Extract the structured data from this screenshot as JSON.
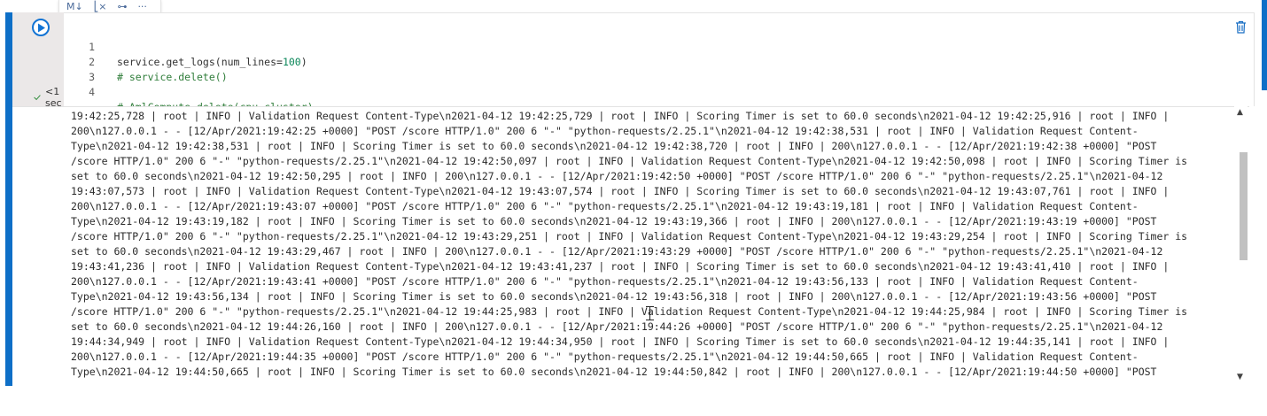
{
  "cell_toolbar": {
    "markdown_label": "M↓",
    "clear_label": "⎣×",
    "split_label": "⊶",
    "more_label": "···"
  },
  "code": {
    "lines": [
      {
        "no": "1",
        "text": "service.get_logs(num_lines=100)"
      },
      {
        "no": "2",
        "text": "# service.delete()"
      },
      {
        "no": "3",
        "text": ""
      },
      {
        "no": "4",
        "text": "# AmlCompute.delete(cpu_cluster)"
      }
    ]
  },
  "execution": {
    "status_icon": "checkmark-icon",
    "duration": "<1 sec"
  },
  "output": {
    "lines": [
      "19:42:25,728 | root | INFO | Validation Request Content-Type\\n2021-04-12 19:42:25,729 | root | INFO | Scoring Timer is set to 60.0 seconds\\n2021-04-12 19:42:25,916 | root | INFO |",
      "200\\n127.0.0.1 - - [12/Apr/2021:19:42:25 +0000] \"POST /score HTTP/1.0\" 200 6 \"-\" \"python-requests/2.25.1\"\\n2021-04-12 19:42:38,531 | root | INFO | Validation Request Content-",
      "Type\\n2021-04-12 19:42:38,531 | root | INFO | Scoring Timer is set to 60.0 seconds\\n2021-04-12 19:42:38,720 | root | INFO | 200\\n127.0.0.1 - - [12/Apr/2021:19:42:38 +0000] \"POST",
      "/score HTTP/1.0\" 200 6 \"-\" \"python-requests/2.25.1\"\\n2021-04-12 19:42:50,097 | root | INFO | Validation Request Content-Type\\n2021-04-12 19:42:50,098 | root | INFO | Scoring Timer is",
      "set to 60.0 seconds\\n2021-04-12 19:42:50,295 | root | INFO | 200\\n127.0.0.1 - - [12/Apr/2021:19:42:50 +0000] \"POST /score HTTP/1.0\" 200 6 \"-\" \"python-requests/2.25.1\"\\n2021-04-12",
      "19:43:07,573 | root | INFO | Validation Request Content-Type\\n2021-04-12 19:43:07,574 | root | INFO | Scoring Timer is set to 60.0 seconds\\n2021-04-12 19:43:07,761 | root | INFO |",
      "200\\n127.0.0.1 - - [12/Apr/2021:19:43:07 +0000] \"POST /score HTTP/1.0\" 200 6 \"-\" \"python-requests/2.25.1\"\\n2021-04-12 19:43:19,181 | root | INFO | Validation Request Content-",
      "Type\\n2021-04-12 19:43:19,182 | root | INFO | Scoring Timer is set to 60.0 seconds\\n2021-04-12 19:43:19,366 | root | INFO | 200\\n127.0.0.1 - - [12/Apr/2021:19:43:19 +0000] \"POST",
      "/score HTTP/1.0\" 200 6 \"-\" \"python-requests/2.25.1\"\\n2021-04-12 19:43:29,251 | root | INFO | Validation Request Content-Type\\n2021-04-12 19:43:29,254 | root | INFO | Scoring Timer is",
      "set to 60.0 seconds\\n2021-04-12 19:43:29,467 | root | INFO | 200\\n127.0.0.1 - - [12/Apr/2021:19:43:29 +0000] \"POST /score HTTP/1.0\" 200 6 \"-\" \"python-requests/2.25.1\"\\n2021-04-12",
      "19:43:41,236 | root | INFO | Validation Request Content-Type\\n2021-04-12 19:43:41,237 | root | INFO | Scoring Timer is set to 60.0 seconds\\n2021-04-12 19:43:41,410 | root | INFO |",
      "200\\n127.0.0.1 - - [12/Apr/2021:19:43:41 +0000] \"POST /score HTTP/1.0\" 200 6 \"-\" \"python-requests/2.25.1\"\\n2021-04-12 19:43:56,133 | root | INFO | Validation Request Content-",
      "Type\\n2021-04-12 19:43:56,134 | root | INFO | Scoring Timer is set to 60.0 seconds\\n2021-04-12 19:43:56,318 | root | INFO | 200\\n127.0.0.1 - - [12/Apr/2021:19:43:56 +0000] \"POST",
      "/score HTTP/1.0\" 200 6 \"-\" \"python-requests/2.25.1\"\\n2021-04-12 19:44:25,983 | root | INFO | Validation Request Content-Type\\n2021-04-12 19:44:25,984 | root | INFO | Scoring Timer is",
      "set to 60.0 seconds\\n2021-04-12 19:44:26,160 | root | INFO | 200\\n127.0.0.1 - - [12/Apr/2021:19:44:26 +0000] \"POST /score HTTP/1.0\" 200 6 \"-\" \"python-requests/2.25.1\"\\n2021-04-12",
      "19:44:34,949 | root | INFO | Validation Request Content-Type\\n2021-04-12 19:44:34,950 | root | INFO | Scoring Timer is set to 60.0 seconds\\n2021-04-12 19:44:35,141 | root | INFO |",
      "200\\n127.0.0.1 - - [12/Apr/2021:19:44:35 +0000] \"POST /score HTTP/1.0\" 200 6 \"-\" \"python-requests/2.25.1\"\\n2021-04-12 19:44:50,665 | root | INFO | Validation Request Content-",
      "Type\\n2021-04-12 19:44:50,665 | root | INFO | Scoring Timer is set to 60.0 seconds\\n2021-04-12 19:44:50,842 | root | INFO | 200\\n127.0.0.1 - - [12/Apr/2021:19:44:50 +0000] \"POST"
    ]
  },
  "icons": {
    "run": "play-icon",
    "delete": "trash-icon"
  },
  "colors": {
    "accent": "#0e6fc7",
    "comment": "#2f7d3a",
    "number": "#098658"
  }
}
